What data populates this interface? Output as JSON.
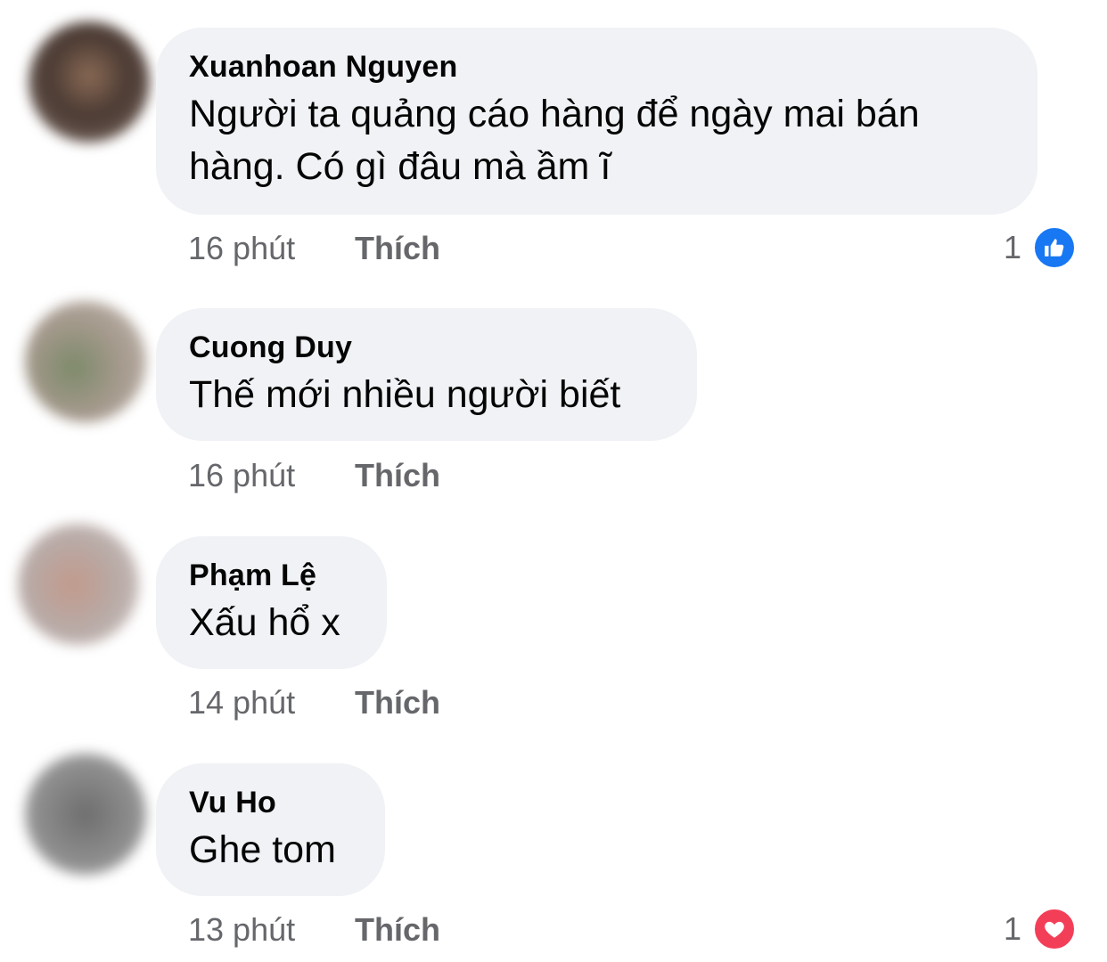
{
  "colors": {
    "bubble": "#f0f2f5",
    "secondary_text": "#65676b",
    "like_blue": "#1877f2",
    "love_red": "#f33e58"
  },
  "comments": [
    {
      "author": "Xuanhoan Nguyen",
      "text": "Người ta quảng cáo hàng để ngày mai bán\nhàng. Có gì đâu mà ầm ĩ",
      "time": "16 phút",
      "like_label": "Thích",
      "reaction": {
        "count": "1",
        "icon": "like-icon"
      }
    },
    {
      "author": "Cuong Duy",
      "text": "Thế mới nhiều người biết",
      "time": "16 phút",
      "like_label": "Thích"
    },
    {
      "author": "Phạm Lệ",
      "text": "Xấu hổ x",
      "time": "14 phút",
      "like_label": "Thích"
    },
    {
      "author": "Vu Ho",
      "text": "Ghe tom",
      "time": "13 phút",
      "like_label": "Thích",
      "reaction": {
        "count": "1",
        "icon": "love-icon"
      }
    }
  ]
}
